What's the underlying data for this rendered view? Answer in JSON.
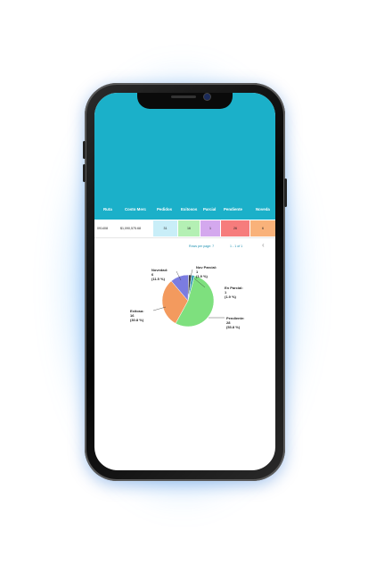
{
  "table": {
    "headers": [
      "Ruta",
      "Costo Merc",
      "Pedidos",
      "Exitosos",
      "Parcial",
      "Pendiente",
      "Noveda"
    ],
    "row": {
      "ruta": "091408",
      "costo": "$1,090,575.68",
      "pedidos": "31",
      "exitosos": "16",
      "parcial": "1",
      "pendiente": "26",
      "novedad": "6"
    },
    "colors": {
      "header": "#1bb0c9",
      "pedidos": "#c9eef8",
      "exitosos": "#b4f0b4",
      "parcial": "#d4a8ee",
      "pendiente": "#f67c7c",
      "novedad": "#f9b27a"
    }
  },
  "pagination": {
    "rows_per_page": "Rows per page: 7",
    "range": "1 - 1 of 1"
  },
  "chart_data": {
    "type": "pie",
    "slices": [
      {
        "name": "Pendiente",
        "count": "28",
        "percent": "(53.8 %)",
        "value": 53.8,
        "color": "#7ee07e"
      },
      {
        "name": "Exitosa",
        "count": "16",
        "percent": "(30.8 %)",
        "value": 30.8,
        "color": "#f39a5e"
      },
      {
        "name": "Novedad",
        "count": "6",
        "percent": "(11.5 %)",
        "value": 11.5,
        "color": "#7b7ce0"
      },
      {
        "name": "Nov Parcial",
        "count": "1",
        "percent": "(1.9 %)",
        "value": 1.9,
        "color": "#3c3c3c"
      },
      {
        "name": "En Parcial",
        "count": "1",
        "percent": "(1.9 %)",
        "value": 1.9,
        "color": "#3fa0b8"
      }
    ],
    "labels": {
      "novedad": {
        "line1": "Novedad:",
        "line2": "6",
        "line3": "(11.5 %)"
      },
      "nov_parcial": {
        "line1": "Nov Parcial:",
        "line2": "1",
        "line3": "(1.9 %)"
      },
      "en_parcial": {
        "line1": "En Parcial:",
        "line2": "1",
        "line3": "(1.9 %)"
      },
      "exitosa": {
        "line1": "Exitosa:",
        "line2": "16",
        "line3": "(30.8 %)"
      },
      "pendiente": {
        "line1": "Pendiente:",
        "line2": "28",
        "line3": "(53.8 %)"
      }
    }
  }
}
